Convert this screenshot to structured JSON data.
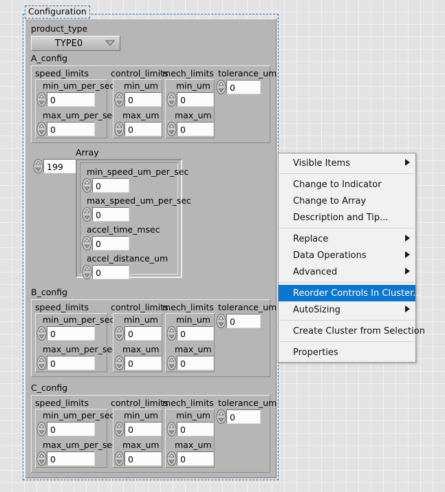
{
  "panel": {
    "title": "Configuration",
    "product_type_label": "product_type",
    "product_type_value": "TYPE0",
    "product_type_options": [
      "TYPE0"
    ],
    "array_label": "Array",
    "array_index_value": "199",
    "clusters": [
      {
        "name": "A_config",
        "groups": [
          {
            "name": "speed_limits",
            "fields": [
              {
                "label": "min_um_per_sec",
                "value": "0"
              },
              {
                "label": "max_um_per_sec",
                "value": "0"
              }
            ]
          },
          {
            "name": "control_limits",
            "fields": [
              {
                "label": "min_um",
                "value": "0"
              },
              {
                "label": "max_um",
                "value": "0"
              }
            ]
          },
          {
            "name": "mech_limits",
            "fields": [
              {
                "label": "min_um",
                "value": "0"
              },
              {
                "label": "max_um",
                "value": "0"
              }
            ]
          }
        ],
        "tolerance": {
          "label": "tolerance_um",
          "value": "0"
        }
      },
      {
        "name": "B_config",
        "groups": [
          {
            "name": "speed_limits",
            "fields": [
              {
                "label": "min_um_per_sec",
                "value": "0"
              },
              {
                "label": "max_um_per_sec",
                "value": "0"
              }
            ]
          },
          {
            "name": "control_limits",
            "fields": [
              {
                "label": "min_um",
                "value": "0"
              },
              {
                "label": "max_um",
                "value": "0"
              }
            ]
          },
          {
            "name": "mech_limits",
            "fields": [
              {
                "label": "min_um",
                "value": "0"
              },
              {
                "label": "max_um",
                "value": "0"
              }
            ]
          }
        ],
        "tolerance": {
          "label": "tolerance_um",
          "value": "0"
        }
      },
      {
        "name": "C_config",
        "groups": [
          {
            "name": "speed_limits",
            "fields": [
              {
                "label": "min_um_per_sec",
                "value": "0"
              },
              {
                "label": "max_um_per_sec",
                "value": "0"
              }
            ]
          },
          {
            "name": "control_limits",
            "fields": [
              {
                "label": "min_um",
                "value": "0"
              },
              {
                "label": "max_um",
                "value": "0"
              }
            ]
          },
          {
            "name": "mech_limits",
            "fields": [
              {
                "label": "min_um",
                "value": "0"
              },
              {
                "label": "max_um",
                "value": "0"
              }
            ]
          }
        ],
        "tolerance": {
          "label": "tolerance_um",
          "value": "0"
        }
      }
    ],
    "array_fields": [
      {
        "label": "min_speed_um_per_sec",
        "value": "0"
      },
      {
        "label": "max_speed_um_per_sec",
        "value": "0"
      },
      {
        "label": "accel_time_msec",
        "value": "0"
      },
      {
        "label": "accel_distance_um",
        "value": "0"
      }
    ]
  },
  "context_menu": {
    "items": [
      {
        "label": "Visible Items",
        "submenu": true,
        "selected": false,
        "separator_after": true
      },
      {
        "label": "Change to Indicator",
        "submenu": false,
        "selected": false,
        "separator_after": false
      },
      {
        "label": "Change to Array",
        "submenu": false,
        "selected": false,
        "separator_after": false
      },
      {
        "label": "Description and Tip...",
        "submenu": false,
        "selected": false,
        "separator_after": true
      },
      {
        "label": "Replace",
        "submenu": true,
        "selected": false,
        "separator_after": false
      },
      {
        "label": "Data Operations",
        "submenu": true,
        "selected": false,
        "separator_after": false
      },
      {
        "label": "Advanced",
        "submenu": true,
        "selected": false,
        "separator_after": true
      },
      {
        "label": "Reorder Controls In Cluster...",
        "submenu": false,
        "selected": true,
        "separator_after": false
      },
      {
        "label": "AutoSizing",
        "submenu": true,
        "selected": false,
        "separator_after": true
      },
      {
        "label": "Create Cluster from Selection",
        "submenu": false,
        "selected": false,
        "separator_after": true
      },
      {
        "label": "Properties",
        "submenu": false,
        "selected": false,
        "separator_after": false
      }
    ]
  },
  "colors": {
    "menu_highlight": "#0b76d0",
    "selection_dash": "#2f6fb5",
    "panel_gray": "#b6b6b6",
    "canvas_gray": "#e3e3e3"
  }
}
